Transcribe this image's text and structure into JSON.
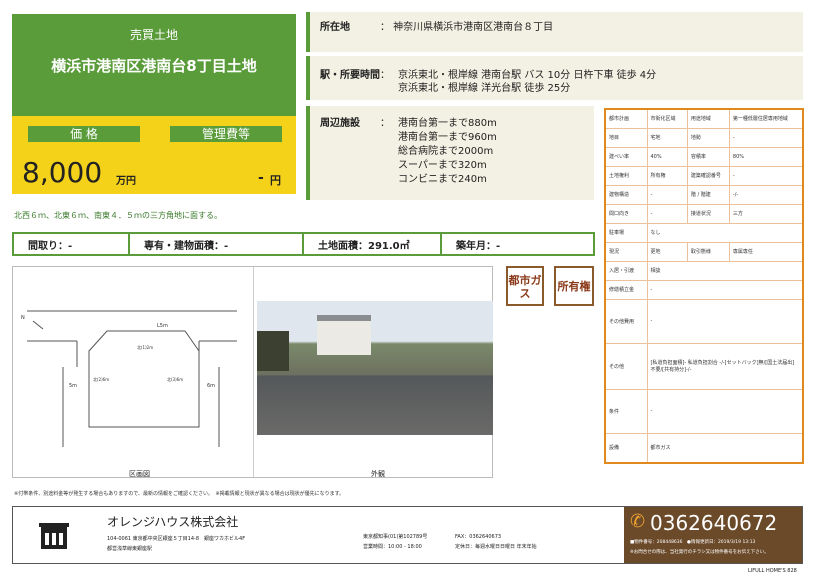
{
  "header": {
    "category": "売買土地",
    "property_name": "横浜市港南区港南台8丁目土地"
  },
  "price": {
    "label": "価 格",
    "mgmt_label": "管理費等",
    "value": "8,000",
    "unit": "万円",
    "mgmt_value": "-",
    "mgmt_unit": "円"
  },
  "location": {
    "label": "所在地",
    "value": "： 神奈川県横浜市港南区港南台８丁目"
  },
  "station": {
    "label": "駅・所要時間",
    "line1": "京浜東北・根岸線 港南台駅 バス 10分 日杵下車 徒歩 4分",
    "line2": "京浜東北・根岸線 洋光台駅 徒歩 25分",
    "colon": "："
  },
  "nearby": {
    "label": "周辺施設",
    "colon": "：",
    "items": [
      "港南台第一まで880m",
      "港南台第一まで960m",
      "総合病院まで2000m",
      "スーパーまで320m",
      "コンビニまで240m"
    ]
  },
  "note": "北西６ｍ、北東６ｍ、南東４．５ｍの三方角地に面する。",
  "stats": {
    "layout": "間取り：-",
    "building_area": "専有・建物面積：-",
    "land_area": "土地面積：291.0㎡",
    "age": "築年月：-"
  },
  "badges": {
    "gas": "都市ガス",
    "ownership": "所有権"
  },
  "images": {
    "plan_caption": "区画図",
    "photo_caption": "外観",
    "plan_labels": {
      "north": "N",
      "r1": "L5m",
      "r2": "5m",
      "r3": "6m",
      "r4": "6m",
      "d1": "北(1)2m",
      "d2": "北(2)6m",
      "d3": "北(3)6m"
    }
  },
  "spec": [
    [
      "都市計画",
      "市街化区域",
      "用途地域",
      "第一種低層住居専用地域"
    ],
    [
      "地目",
      "宅地",
      "地勢",
      "-"
    ],
    [
      "建ぺい率",
      "40%",
      "容積率",
      "80%"
    ],
    [
      "土地権利",
      "所有権",
      "建築確認番号",
      "-"
    ],
    [
      "建物構造",
      "-",
      "階 / 階建",
      "-/-"
    ],
    [
      "間口向き",
      "-",
      "接道状況",
      "三方"
    ],
    [
      "駐車場",
      "なし"
    ],
    [
      "現況",
      "更地",
      "取引態様",
      "専属専任"
    ],
    [
      "入居・引渡",
      "相談"
    ],
    [
      "修繕積立金",
      "-"
    ],
    [
      "その他費用",
      "-"
    ],
    [
      "その他",
      "[私道負担面積]- 私道負担割合 -/-[セットバック]無/[国土法届出]不要/[共有持分]-/-"
    ],
    [
      "条件",
      "-"
    ],
    [
      "設備",
      "都市ガス"
    ]
  ],
  "disclaimer": "※付帯条件、別途料金等が発生する場合もありますので、最新の情報をご確認ください。　※掲載情報と現状が異なる場合は現状が優先になります。",
  "company": {
    "name": "オレンジハウス株式会社",
    "address": "104-0061 東京都中央区銀座５丁目14-8　銀座ワカホビル4F",
    "station": "都営浅草線東銀座駅",
    "license": "東京都知事(01)第102789号",
    "hours": "営業時間：10:00 - 18:00",
    "fax": "FAX：0362640673",
    "holiday": "定休日：毎週水曜日日曜日 年末年始"
  },
  "contact": {
    "phone": "0362640672",
    "id_line": "■物件番号：208448636　●情報更新日：2019/3/19 13:13",
    "note": "※お問合せの際は、当社発行のチラシ又は物件番号をお伝え下さい。"
  },
  "brand": "LIFULL HOME'S 828"
}
